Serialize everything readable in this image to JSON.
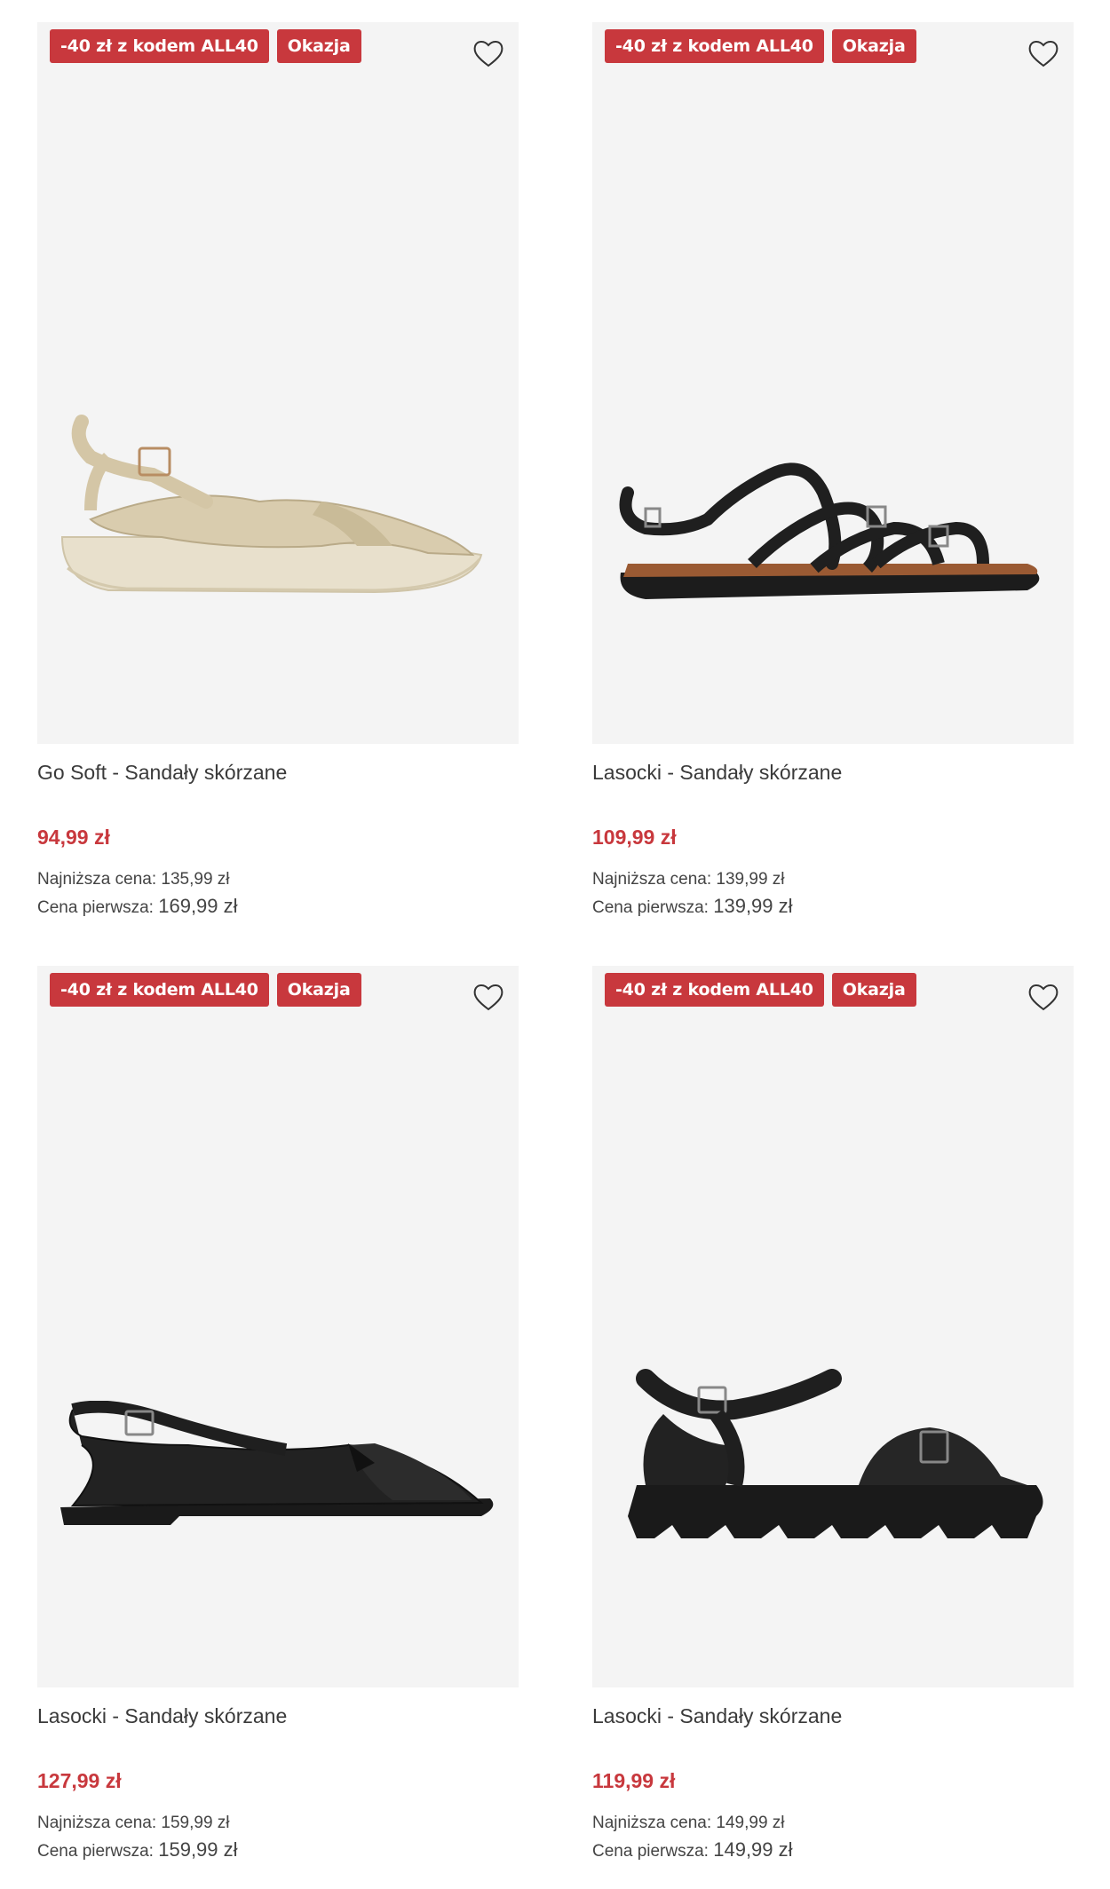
{
  "products": [
    {
      "badges": [
        "-40 zł z kodem ALL40",
        "Okazja"
      ],
      "title": "Go Soft - Sandały skórzane",
      "price": "94,99 zł",
      "lowest_label": "Najniższa cena:",
      "lowest_value": "135,99 zł",
      "first_label": "Cena pierwsza:",
      "first_value": "169,99 zł",
      "icon": "heart-icon"
    },
    {
      "badges": [
        "-40 zł z kodem ALL40",
        "Okazja"
      ],
      "title": "Lasocki - Sandały skórzane",
      "price": "109,99 zł",
      "lowest_label": "Najniższa cena:",
      "lowest_value": "139,99 zł",
      "first_label": "Cena pierwsza:",
      "first_value": "139,99 zł",
      "icon": "heart-icon"
    },
    {
      "badges": [
        "-40 zł z kodem ALL40",
        "Okazja"
      ],
      "title": "Lasocki - Sandały skórzane",
      "price": "127,99 zł",
      "lowest_label": "Najniższa cena:",
      "lowest_value": "159,99 zł",
      "first_label": "Cena pierwsza:",
      "first_value": "159,99 zł",
      "icon": "heart-icon"
    },
    {
      "badges": [
        "-40 zł z kodem ALL40",
        "Okazja"
      ],
      "title": "Lasocki - Sandały skórzane",
      "price": "119,99 zł",
      "lowest_label": "Najniższa cena:",
      "lowest_value": "149,99 zł",
      "first_label": "Cena pierwsza:",
      "first_value": "149,99 zł",
      "icon": "heart-icon"
    }
  ],
  "colors": {
    "badge_bg": "#c8383d",
    "price": "#c8383d",
    "image_bg": "#f4f4f4"
  }
}
